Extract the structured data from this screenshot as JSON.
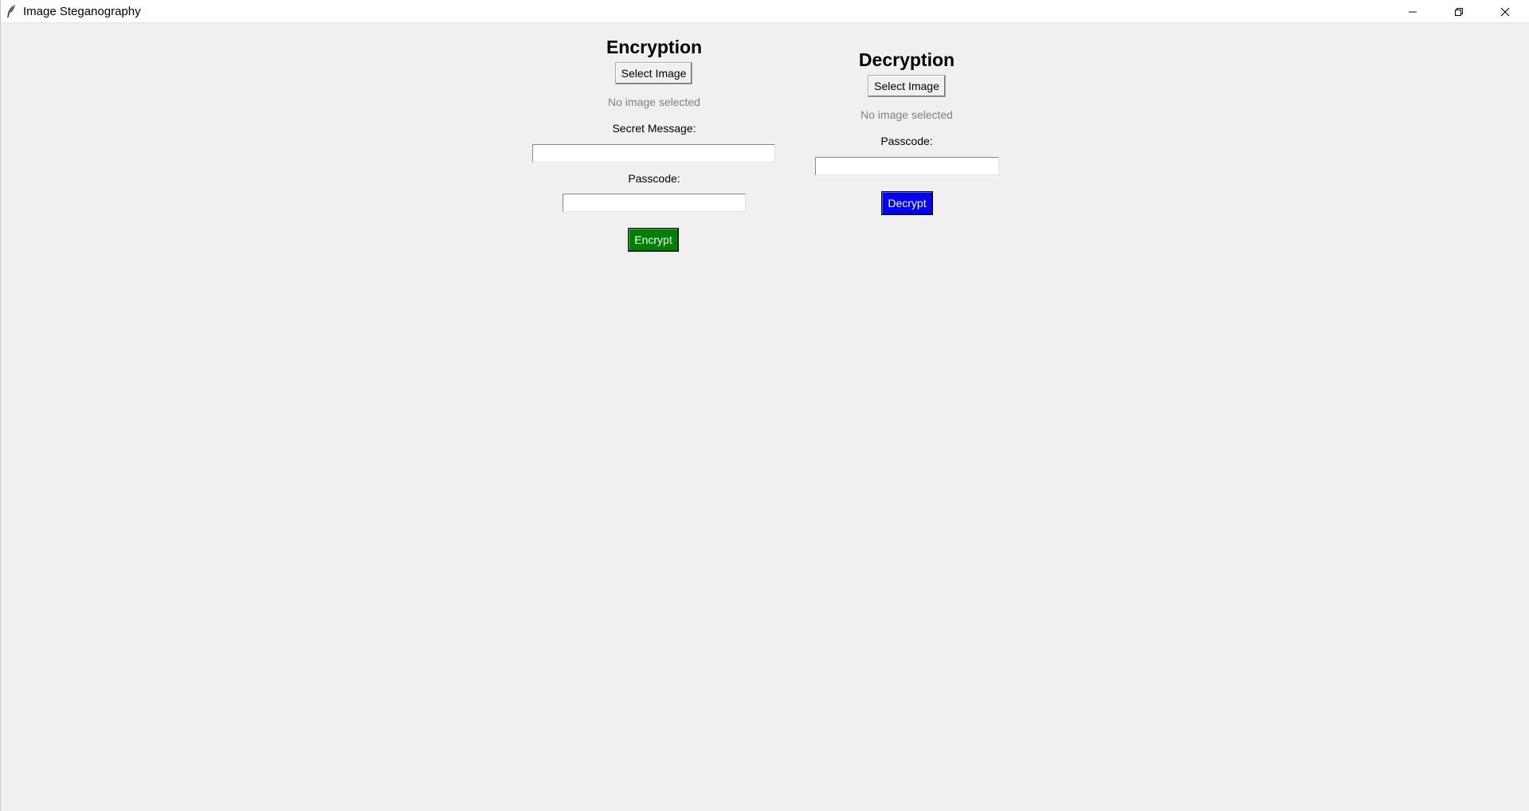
{
  "window": {
    "title": "Image Steganography",
    "controls": [
      "minimize-icon",
      "restore-icon",
      "close-icon"
    ]
  },
  "encryption": {
    "heading": "Encryption",
    "select_label": "Select Image",
    "status": "No image selected",
    "message_label": "Secret Message:",
    "message_value": "",
    "passcode_label": "Passcode:",
    "passcode_value": "",
    "action_label": "Encrypt",
    "action_color": "#008000"
  },
  "decryption": {
    "heading": "Decryption",
    "select_label": "Select Image",
    "status": "No image selected",
    "passcode_label": "Passcode:",
    "passcode_value": "",
    "action_label": "Decrypt",
    "action_color": "#0000ff"
  }
}
